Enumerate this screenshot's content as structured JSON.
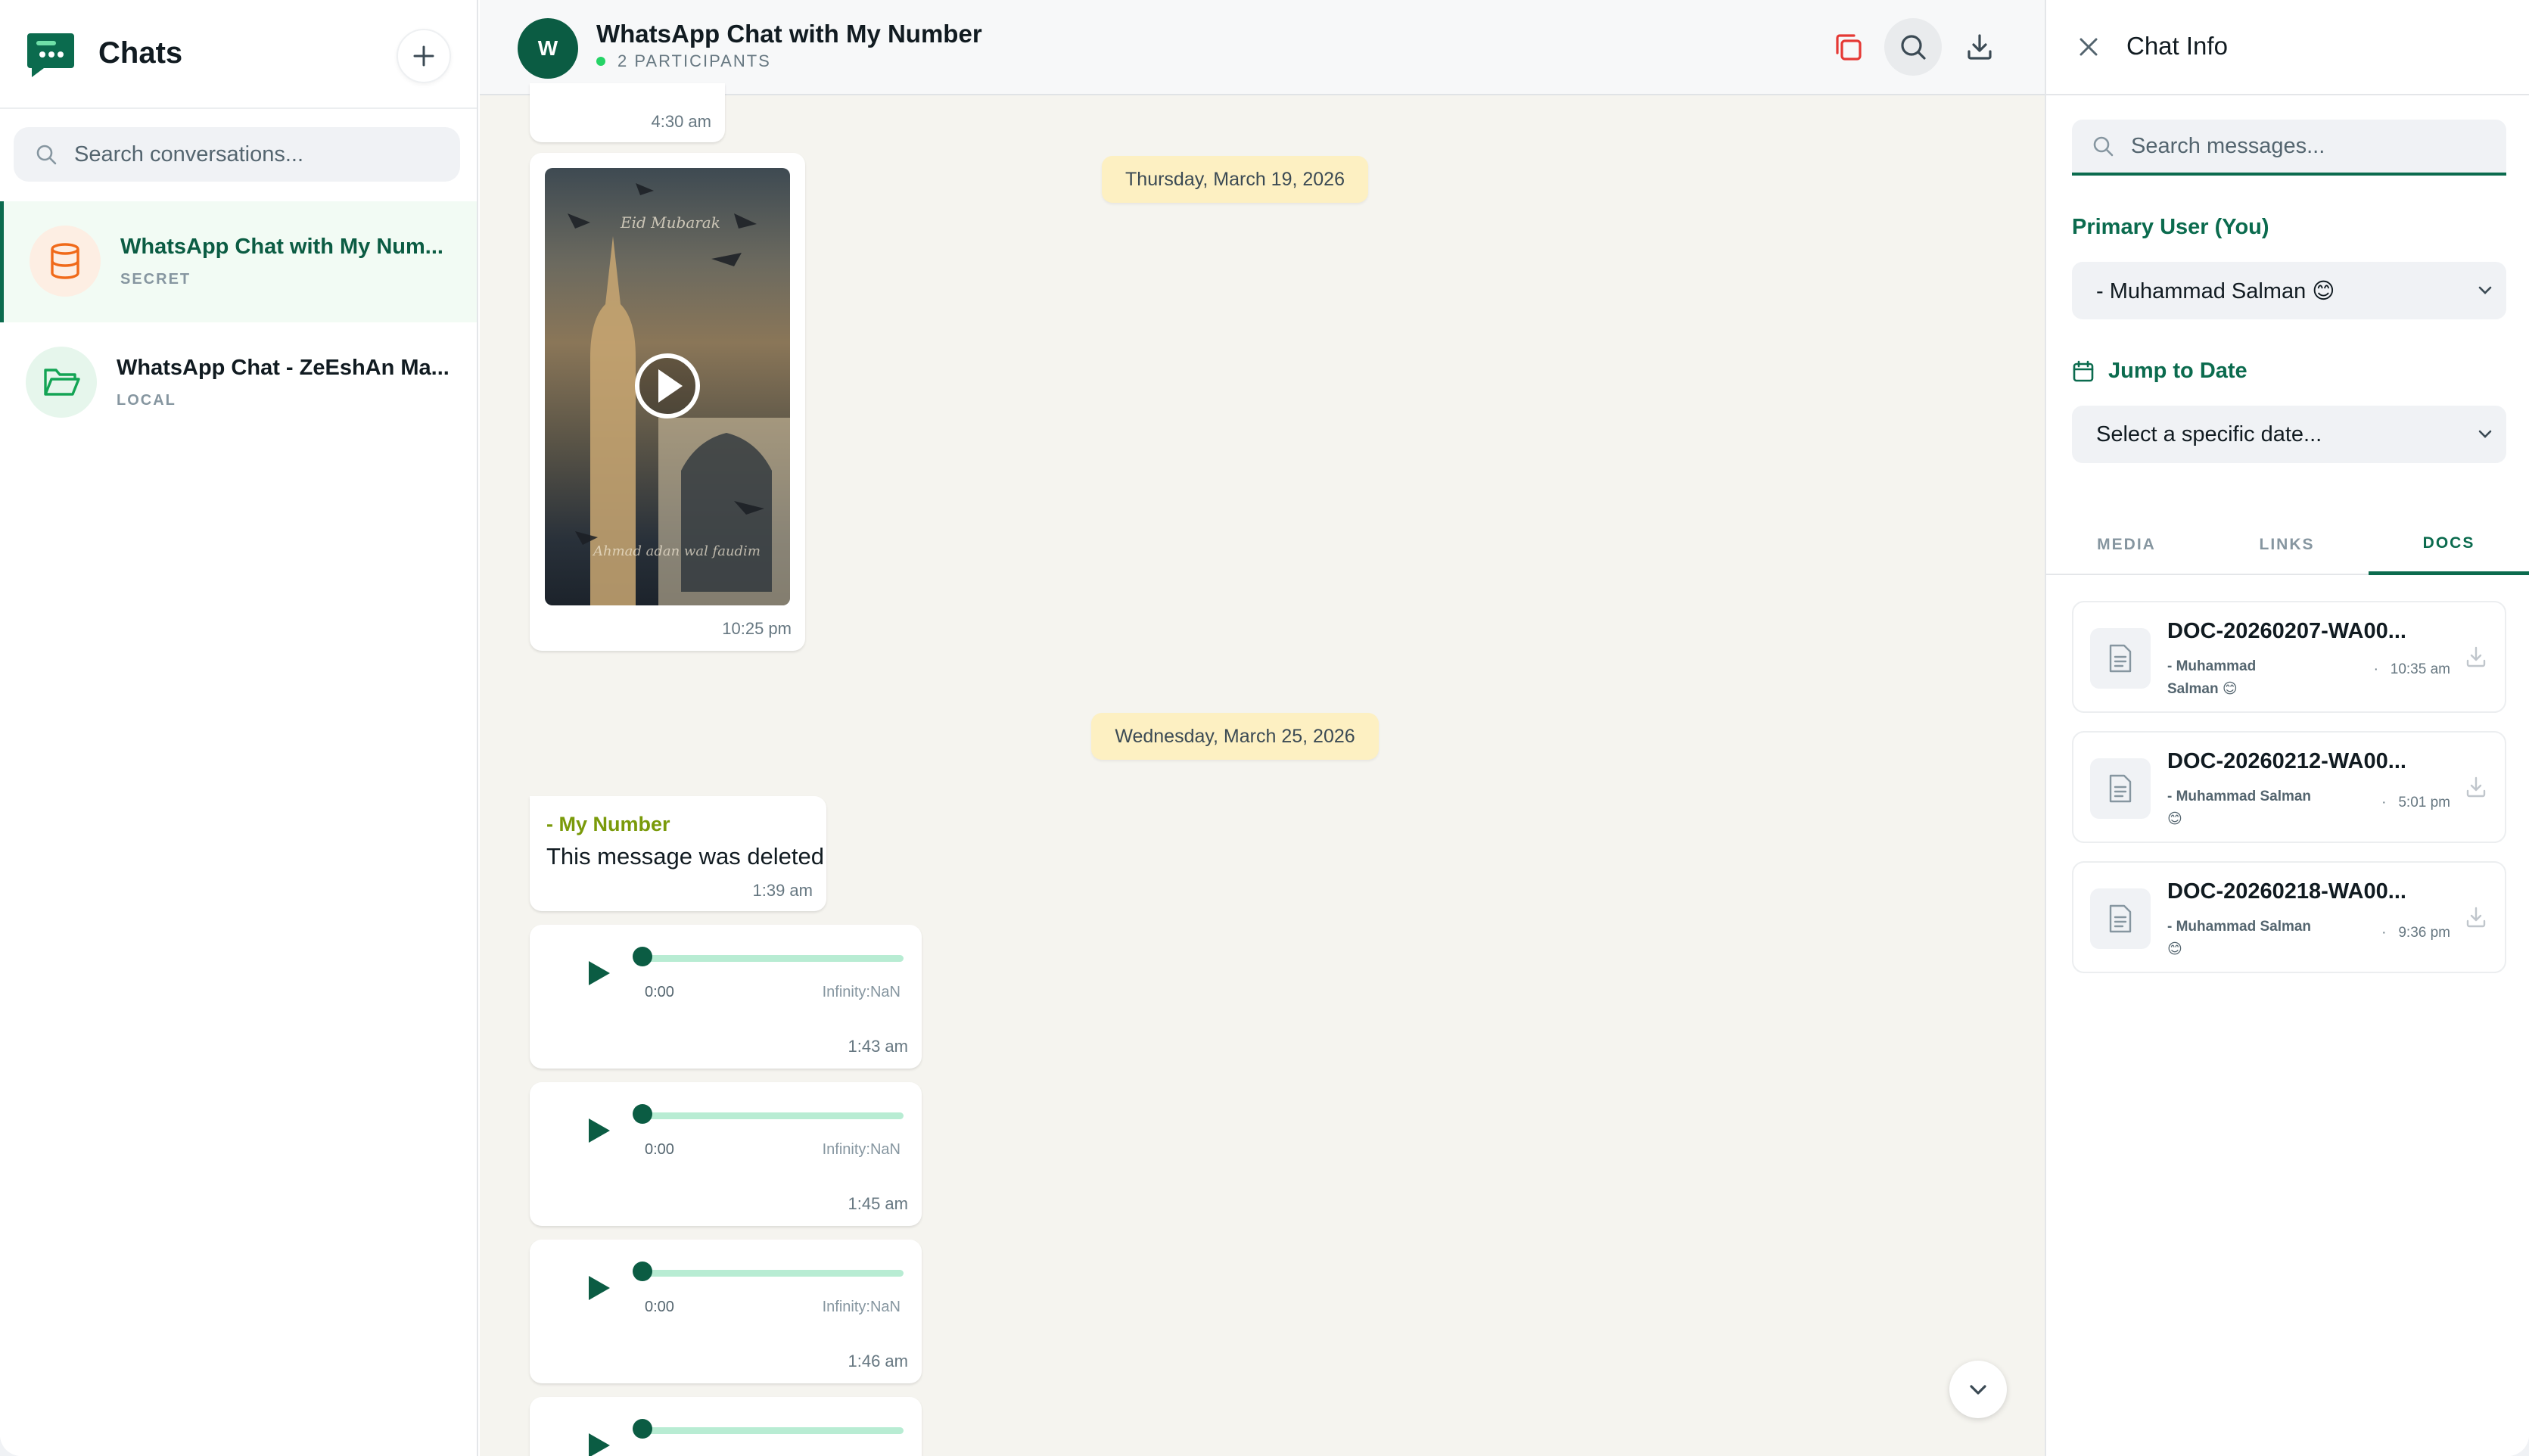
{
  "sidebar": {
    "title": "Chats",
    "search_placeholder": "Search conversations...",
    "chats": [
      {
        "name": "WhatsApp Chat with My Num...",
        "tag": "SECRET",
        "icon": "database-icon",
        "color": "#f06a1a"
      },
      {
        "name": "WhatsApp Chat - ZeEshAn Ma...",
        "tag": "LOCAL",
        "icon": "folder-open-icon",
        "color": "#13a454"
      }
    ]
  },
  "chat": {
    "avatar_letter": "W",
    "title": "WhatsApp Chat with My Number",
    "participants": "2 PARTICIPANTS",
    "actions": [
      "copy-icon",
      "search-icon",
      "download-icon"
    ],
    "top_time": "4:30 am",
    "video": {
      "time": "10:25 pm",
      "overlay_top": "Eid Mubarak",
      "overlay_bottom": "Ahmad adan wal faudim"
    },
    "date1": "Thursday, March 19, 2026",
    "date2": "Wednesday, March 25, 2026",
    "deleted": {
      "sender": "- My Number",
      "text": "This message was deleted",
      "time": "1:39 am"
    },
    "audios": [
      {
        "current": "0:00",
        "duration": "Infinity:NaN",
        "time": "1:43 am"
      },
      {
        "current": "0:00",
        "duration": "Infinity:NaN",
        "time": "1:45 am"
      },
      {
        "current": "0:00",
        "duration": "Infinity:NaN",
        "time": "1:46 am"
      }
    ]
  },
  "info": {
    "title": "Chat Info",
    "search_placeholder": "Search messages...",
    "primary_label": "Primary User (You)",
    "primary_value": "- Muhammad Salman 😊",
    "jump_label": "Jump to Date",
    "jump_value": "Select a specific date...",
    "tabs": [
      "MEDIA",
      "LINKS",
      "DOCS"
    ],
    "active_tab": "DOCS",
    "docs": [
      {
        "name": "DOC-20260207-WA00...",
        "by": "- Muhammad",
        "by2": "Salman 😊",
        "time": "10:35 am"
      },
      {
        "name": "DOC-20260212-WA00...",
        "by": "- Muhammad Salman",
        "by2": "😊",
        "time": "5:01 pm"
      },
      {
        "name": "DOC-20260218-WA00...",
        "by": "- Muhammad Salman",
        "by2": "😊",
        "time": "9:36 pm"
      }
    ]
  },
  "colors": {
    "accent": "#0b6b4e",
    "date_pill": "#fdf0c2",
    "sender": "#7a9a0a",
    "copy_icon": "#e53935"
  }
}
